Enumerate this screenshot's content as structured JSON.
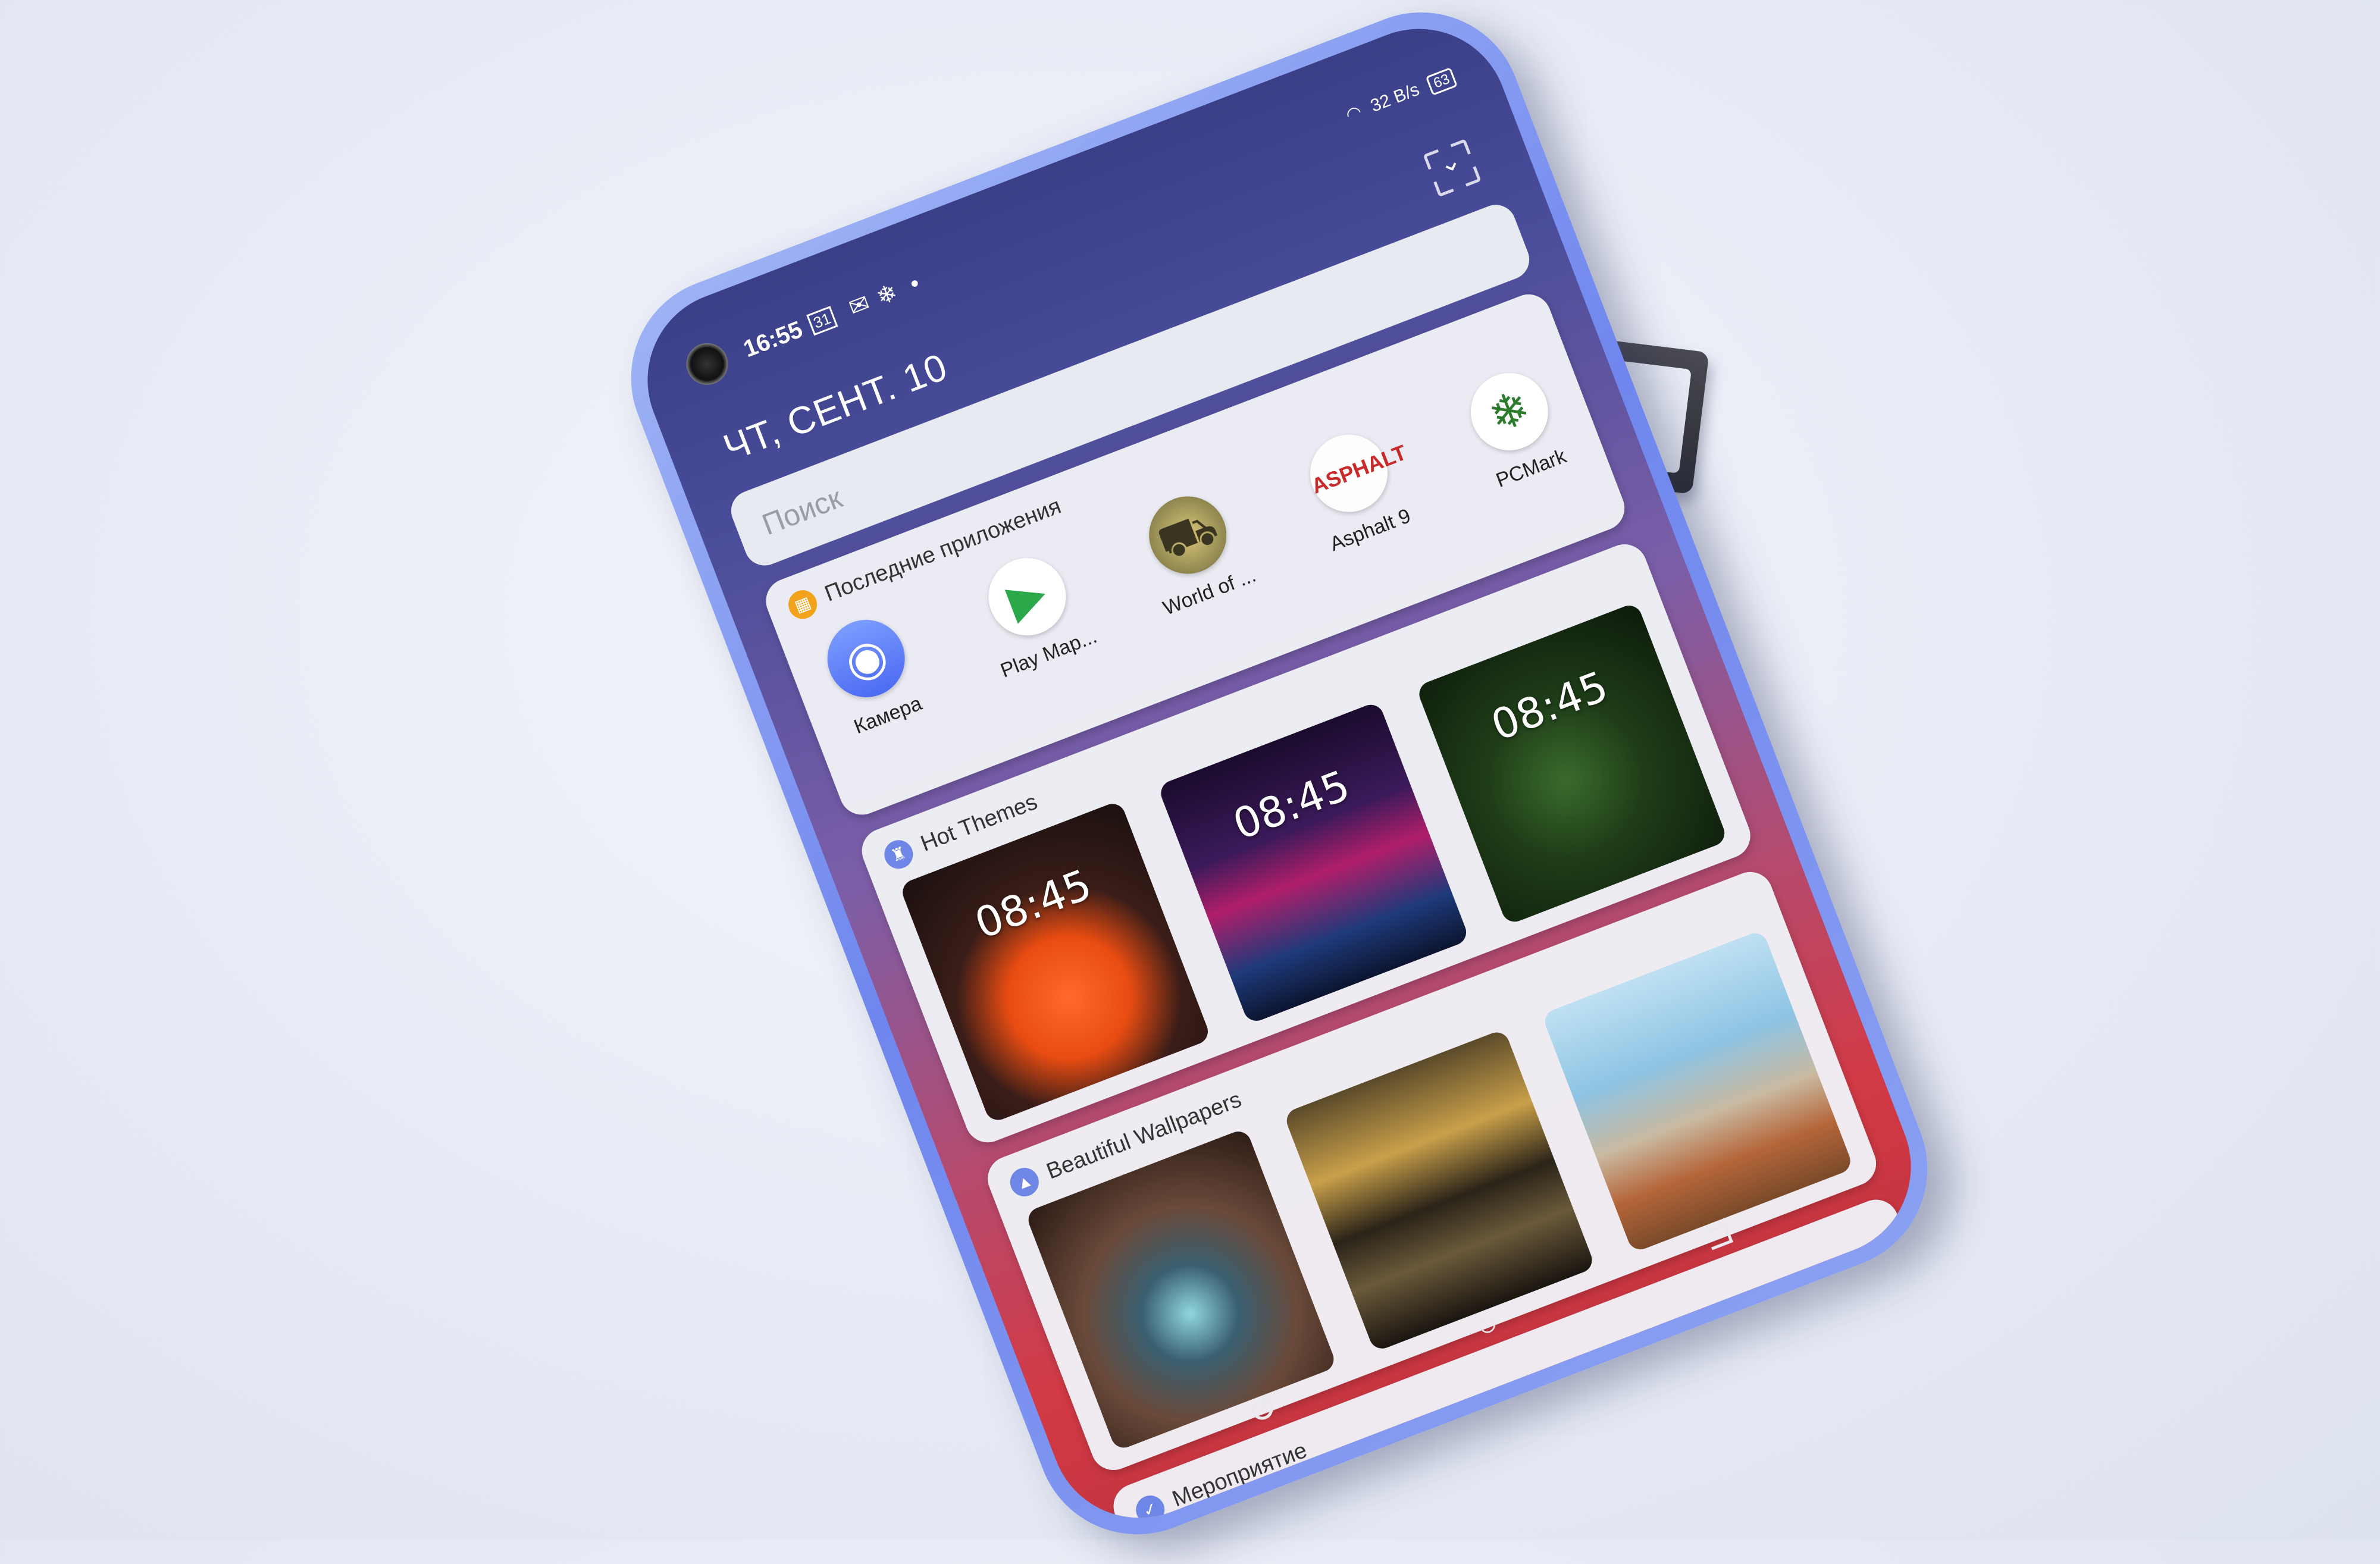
{
  "status_bar": {
    "time": "16:55",
    "calendar_day": "31",
    "net_speed": "32 B/s",
    "battery": "63"
  },
  "date": "ЧТ, СЕНТ. 10",
  "search": {
    "placeholder": "Поиск"
  },
  "recent_apps": {
    "title": "Последние приложения",
    "apps": [
      {
        "label": "Камера",
        "icon": "camera-icon"
      },
      {
        "label": "Play Map...",
        "icon": "play-store-icon"
      },
      {
        "label": "World of ...",
        "icon": "tank-icon"
      },
      {
        "label": "Asphalt 9",
        "icon": "asphalt-icon",
        "badge": "ASPHALT"
      },
      {
        "label": "PCMark",
        "icon": "snowflake-icon"
      }
    ]
  },
  "hot_themes": {
    "title": "Hot Themes",
    "themes": [
      {
        "clock": "08:45"
      },
      {
        "clock": "08:45"
      },
      {
        "clock": "08:45"
      }
    ]
  },
  "wallpapers": {
    "title": "Beautiful Wallpapers"
  },
  "events": {
    "title": "Мероприятие"
  },
  "colors": {
    "accent_orange": "#f3a31b",
    "accent_blue": "#6e86e6",
    "phone_body": "#7b90f0"
  }
}
